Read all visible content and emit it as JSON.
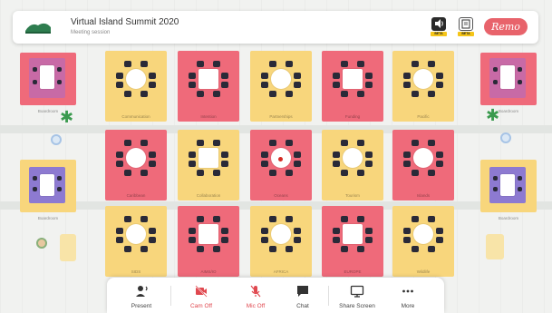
{
  "header": {
    "title": "Virtual Island Summit 2020",
    "subtitle": "Meeting session",
    "beta_buttons": [
      {
        "icon": "speaker-icon",
        "badge": "BETA"
      },
      {
        "icon": "document-icon",
        "badge": "BETA"
      }
    ],
    "brand": "Remo"
  },
  "rooms": [
    {
      "label": "Communication"
    },
    {
      "label": "Intention"
    },
    {
      "label": "Partnerships"
    },
    {
      "label": "Funding"
    },
    {
      "label": "Pacific"
    },
    {
      "label": "Caribbean"
    },
    {
      "label": "Collaboration"
    },
    {
      "label": "Oceans"
    },
    {
      "label": "Tourism"
    },
    {
      "label": "Islands"
    },
    {
      "label": "SIDS"
    },
    {
      "label": "AIMS/IO"
    },
    {
      "label": "AFRICA"
    },
    {
      "label": "EUROPE"
    },
    {
      "label": "Wildlife"
    }
  ],
  "side_rooms": [
    {
      "label": "Boardroom"
    },
    {
      "label": "Boardroom"
    },
    {
      "label": "Boardroom"
    },
    {
      "label": "Boardroom"
    }
  ],
  "colors": {
    "yellow": "#f8d67c",
    "pink": "#ef6a7a",
    "brand": "#e8636b",
    "off": "#e0484f"
  },
  "toolbar": {
    "items": [
      {
        "label": "Present",
        "icon": "present-icon",
        "state": "on"
      },
      {
        "label": "Cam Off",
        "icon": "camera-off-icon",
        "state": "off"
      },
      {
        "label": "Mic Off",
        "icon": "mic-off-icon",
        "state": "off"
      },
      {
        "label": "Chat",
        "icon": "chat-icon",
        "state": "on"
      },
      {
        "label": "Share Screen",
        "icon": "share-screen-icon",
        "state": "on"
      },
      {
        "label": "More",
        "icon": "more-icon",
        "state": "on"
      }
    ]
  }
}
